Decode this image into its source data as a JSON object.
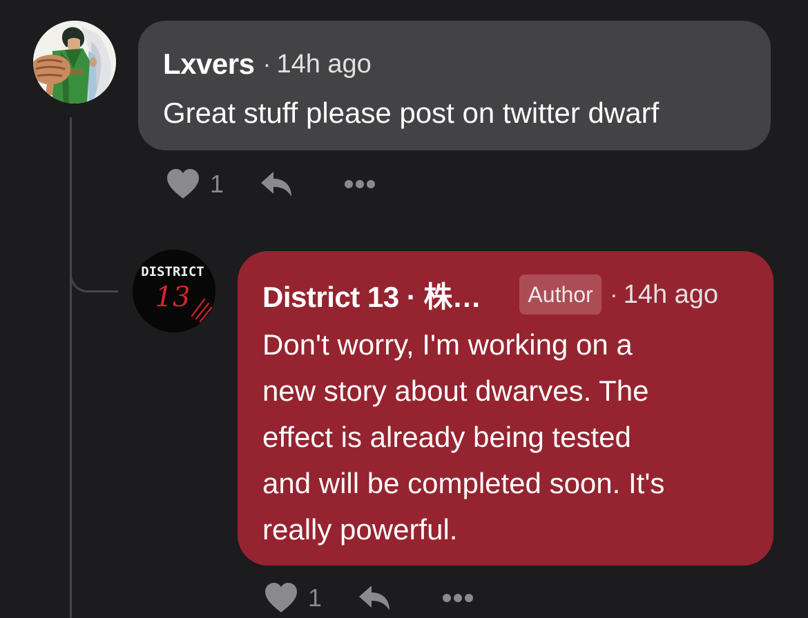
{
  "comments": [
    {
      "author": "Lxvers",
      "time": "14h ago",
      "text": "Great stuff please post on twitter dwarf",
      "likes": "1"
    },
    {
      "author": "District 13 · 株…",
      "badge": "Author",
      "time": "14h ago",
      "text_lines": [
        "Don't worry, I'm working on a",
        "new story about dwarves. The",
        "effect is already being tested",
        "and will be completed soon. It's",
        "really powerful."
      ],
      "likes": "1",
      "avatar_text": {
        "top": "DISTRICT",
        "number": "13"
      }
    }
  ],
  "separator": "·",
  "colors": {
    "background": "#1c1b1d",
    "comment_bubble": "#434244",
    "author_bubble": "#952430",
    "badge": "#ac4d56",
    "muted": "#8a898c"
  },
  "icons": {
    "like": "heart-icon",
    "reply": "reply-arrow-icon",
    "more": "more-dots-icon"
  }
}
